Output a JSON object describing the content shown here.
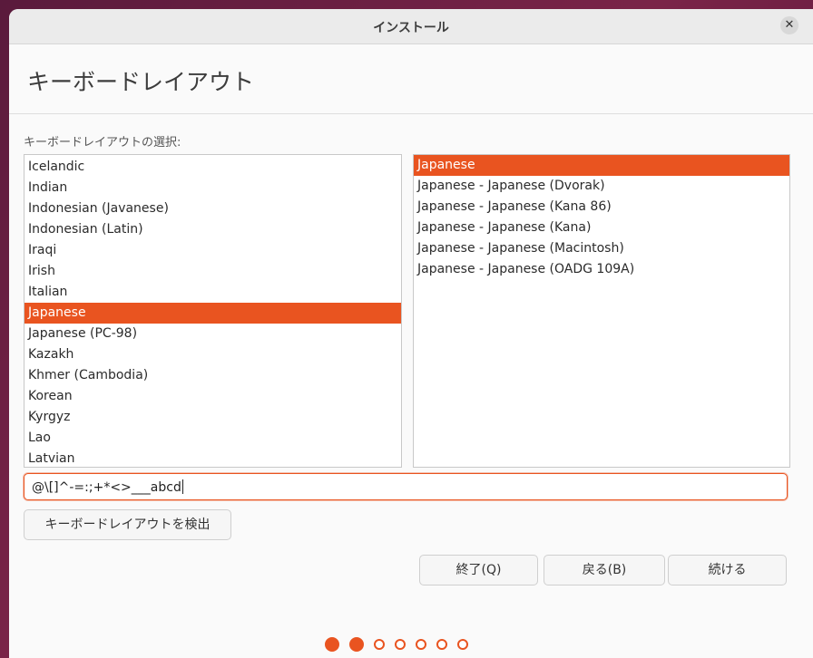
{
  "window": {
    "title": "インストール",
    "close_label": "✕"
  },
  "header": {
    "title": "キーボードレイアウト"
  },
  "layout_select_label": "キーボードレイアウトの選択:",
  "layouts": {
    "items": [
      {
        "label": "Icelandic",
        "selected": false
      },
      {
        "label": "Indian",
        "selected": false
      },
      {
        "label": "Indonesian (Javanese)",
        "selected": false
      },
      {
        "label": "Indonesian (Latin)",
        "selected": false
      },
      {
        "label": "Iraqi",
        "selected": false
      },
      {
        "label": "Irish",
        "selected": false
      },
      {
        "label": "Italian",
        "selected": false
      },
      {
        "label": "Japanese",
        "selected": true
      },
      {
        "label": "Japanese (PC-98)",
        "selected": false
      },
      {
        "label": "Kazakh",
        "selected": false
      },
      {
        "label": "Khmer (Cambodia)",
        "selected": false
      },
      {
        "label": "Korean",
        "selected": false
      },
      {
        "label": "Kyrgyz",
        "selected": false
      },
      {
        "label": "Lao",
        "selected": false
      },
      {
        "label": "Latvian",
        "selected": false
      }
    ]
  },
  "variants": {
    "items": [
      {
        "label": "Japanese",
        "selected": true
      },
      {
        "label": "Japanese - Japanese (Dvorak)",
        "selected": false
      },
      {
        "label": "Japanese - Japanese (Kana 86)",
        "selected": false
      },
      {
        "label": "Japanese - Japanese (Kana)",
        "selected": false
      },
      {
        "label": "Japanese - Japanese (Macintosh)",
        "selected": false
      },
      {
        "label": "Japanese - Japanese (OADG 109A)",
        "selected": false
      }
    ]
  },
  "test_input": {
    "value": "@\\[]^-=:;+*<>___abcd"
  },
  "buttons": {
    "detect": "キーボードレイアウトを検出",
    "quit": "終了(Q)",
    "back": "戻る(B)",
    "continue": "続ける"
  },
  "progress": {
    "total_steps": 7,
    "completed_steps": 2
  },
  "colors": {
    "accent": "#e95420"
  }
}
